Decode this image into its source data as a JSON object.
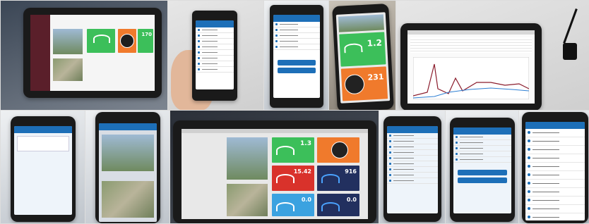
{
  "dashboard": {
    "tablet_top_value": "170",
    "phone_value_small": "1.2",
    "phone_value_large": "231",
    "tablet_bottom_values": [
      "1.3",
      "15.42",
      "916",
      "0.0",
      "0.0"
    ]
  },
  "colors": {
    "brand_blue": "#1d6fb8",
    "green": "#3cbf5a",
    "orange": "#f07a2c",
    "red": "#d9322b",
    "navy": "#22305f"
  }
}
